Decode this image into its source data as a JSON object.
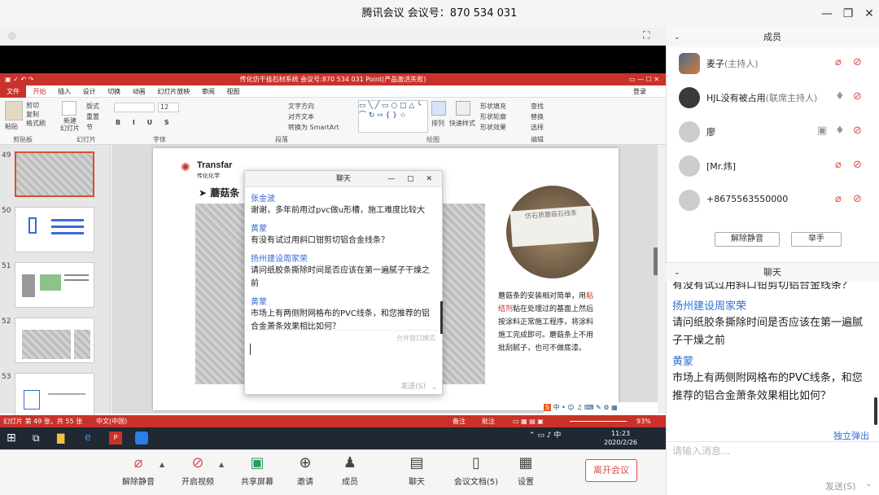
{
  "window": {
    "title": "腾讯会议 会议号：870 534 031"
  },
  "ppt": {
    "title": "传化仿干挂石材系统 会议号:870 534 031 Point(产品激活失败)",
    "tabs": [
      "文件",
      "开始",
      "插入",
      "设计",
      "切换",
      "动画",
      "幻灯片放映",
      "审阅",
      "视图"
    ],
    "login": "登录",
    "ribbon": {
      "paste": "粘贴",
      "cut": "剪切",
      "copy": "复制",
      "format_painter": "格式刷",
      "clipboard": "剪贴板",
      "new_slide": "新建\n幻灯片",
      "layout": "版式",
      "reset": "重置",
      "section": "节",
      "slides_group": "幻灯片",
      "font_group": "字体",
      "font_size": "12",
      "text_dir": "文字方向",
      "align_text": "对齐文本",
      "smartart": "转换为 SmartArt",
      "paragraph_group": "段落",
      "arrange": "排列",
      "quick_styles": "快速样式",
      "shape_fill": "形状填充",
      "shape_outline": "形状轮廓",
      "shape_effects": "形状效果",
      "drawing_group": "绘图",
      "find": "查找",
      "replace": "替换",
      "select": "选择",
      "editing_group": "编辑"
    },
    "thumbs": [
      "49",
      "50",
      "51",
      "52",
      "53"
    ],
    "slide": {
      "logo": "Transfar",
      "logo_cn": "传化化学",
      "heading": "蘑菇条",
      "desc_1": "蘑菇条的安装相对简单，用",
      "desc_red": "粘结剂",
      "desc_2": "粘在处理过的基面上然后按涂料正常施工程序，将涂料施工完成即可。蘑菇条上不用批刮腻子，也可不做底漆。",
      "sample_label": "仿石质蘑菇石线条"
    },
    "status": {
      "slide_info": "幻灯片 第 49 张，共 55 张",
      "lang": "中文(中国)",
      "notes": "备注",
      "comments": "批注",
      "zoom": "93%"
    },
    "taskbar": {
      "time": "11:23",
      "date": "2020/2/26"
    }
  },
  "popup_chat": {
    "title": "聊天",
    "messages": [
      {
        "name": "张金波",
        "text": "谢谢，多年前用过pvc做u形槽，施工难度比较大"
      },
      {
        "name": "黄蒙",
        "text": "有没有试过用斜口钳剪切铝合金线条？"
      },
      {
        "name": "扬州建设周家荣",
        "text": "请问纸胶条撕除时间是否应该在第一遍腻子干燥之前"
      },
      {
        "name": "黄蒙",
        "text": "市场上有两侧附网格布的PVC线条，和您推荐的铝合金萧条效果相比如何？"
      }
    ],
    "hint": "合并窗口模式",
    "send": "发送(S)"
  },
  "toolbar": {
    "unmute": "解除静音",
    "start_video": "开启视频",
    "share": "共享屏幕",
    "invite": "邀请",
    "members": "成员",
    "chat": "聊天",
    "docs": "会议文档(5)",
    "settings": "设置",
    "leave": "离开会议"
  },
  "members_panel": {
    "title": "成员",
    "members": [
      {
        "name": "麦子",
        "role": "(主持人)"
      },
      {
        "name": "HJL没有被占用",
        "role": "(联席主持人)"
      },
      {
        "name": "廖",
        "role": ""
      },
      {
        "name": "[Mr.炜]",
        "role": ""
      },
      {
        "name": "+8675563550000",
        "role": ""
      }
    ],
    "unmute_all": "解除静音",
    "raise_hand": "举手"
  },
  "side_chat": {
    "title": "聊天",
    "cut_top": "有没有试过用斜口钳剪切铝合金线条？",
    "messages": [
      {
        "name": "扬州建设周家荣",
        "text": "请问纸胶条撕除时间是否应该在第一遍腻子干燥之前"
      },
      {
        "name": "黄蒙",
        "text": "市场上有两侧附网格布的PVC线条，和您推荐的铝合金萧条效果相比如何？"
      }
    ],
    "popout": "独立弹出",
    "placeholder": "请输入消息...",
    "send": "发送(S)"
  }
}
